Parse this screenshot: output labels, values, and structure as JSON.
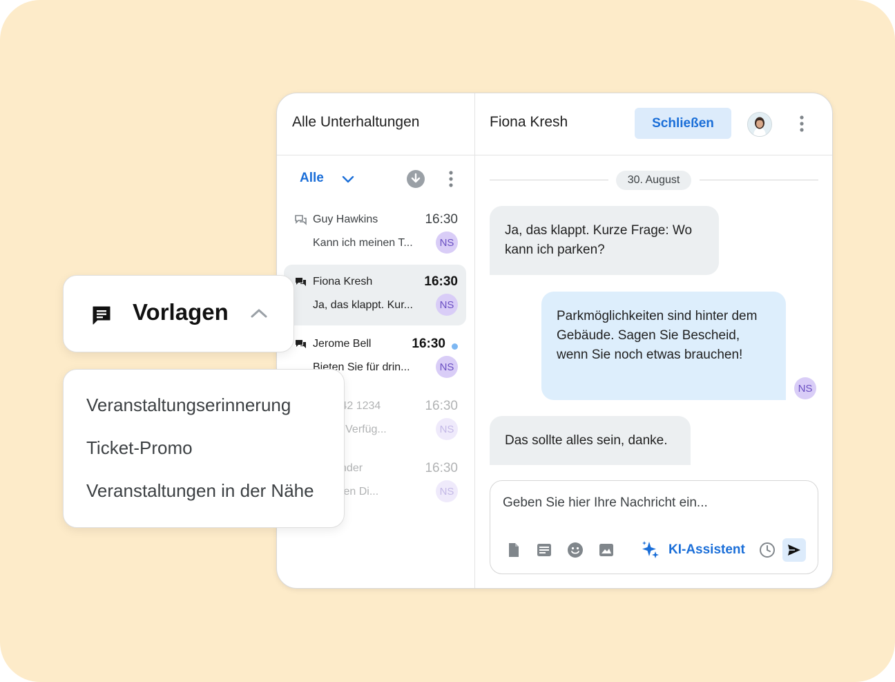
{
  "list": {
    "title": "Alle Unterhaltungen",
    "filter": "Alle",
    "conversations": [
      {
        "name": "Guy Hawkins",
        "time": "16:30",
        "preview": "Kann ich meinen T...",
        "badge": "NS"
      },
      {
        "name": "Fiona Kresh",
        "time": "16:30",
        "preview": "Ja, das klappt. Kur...",
        "badge": "NS"
      },
      {
        "name": "Jerome Bell",
        "time": "16:30",
        "preview": "Bieten Sie für drin...",
        "badge": "NS"
      },
      {
        "name": "+42 242 1234",
        "time": "16:30",
        "preview": "Ist die Verfüg...",
        "badge": "NS"
      },
      {
        "name": "Alexander",
        "time": "16:30",
        "preview": "Ich Ihren Di...",
        "badge": "NS"
      }
    ]
  },
  "chat": {
    "title": "Fiona Kresh",
    "close_label": "Schließen",
    "date": "30. August",
    "messages": [
      {
        "text": "Ja, das klappt. Kurze Frage: Wo kann ich parken?"
      },
      {
        "text": "Parkmöglichkeiten sind hinter dem Gebäude. Sagen Sie Bescheid, wenn Sie noch etwas brauchen!"
      },
      {
        "text": "Das sollte alles sein, danke."
      }
    ],
    "sender_badge": "NS",
    "composer_placeholder": "Geben Sie hier Ihre Nachricht ein...",
    "ai_label": "KI-Assistent"
  },
  "templates": {
    "title": "Vorlagen",
    "items": [
      "Veranstaltungserinnerung",
      "Ticket-Promo",
      "Veranstaltungen in der Nähe"
    ]
  },
  "colors": {
    "background": "#fdebc9",
    "accent": "#1a6ed8",
    "accent_light": "#dcebfb",
    "badge_bg": "#d9cdf7",
    "badge_text": "#6a4fc2",
    "bubble_in": "#eceff1",
    "bubble_out": "#ddeefc"
  }
}
